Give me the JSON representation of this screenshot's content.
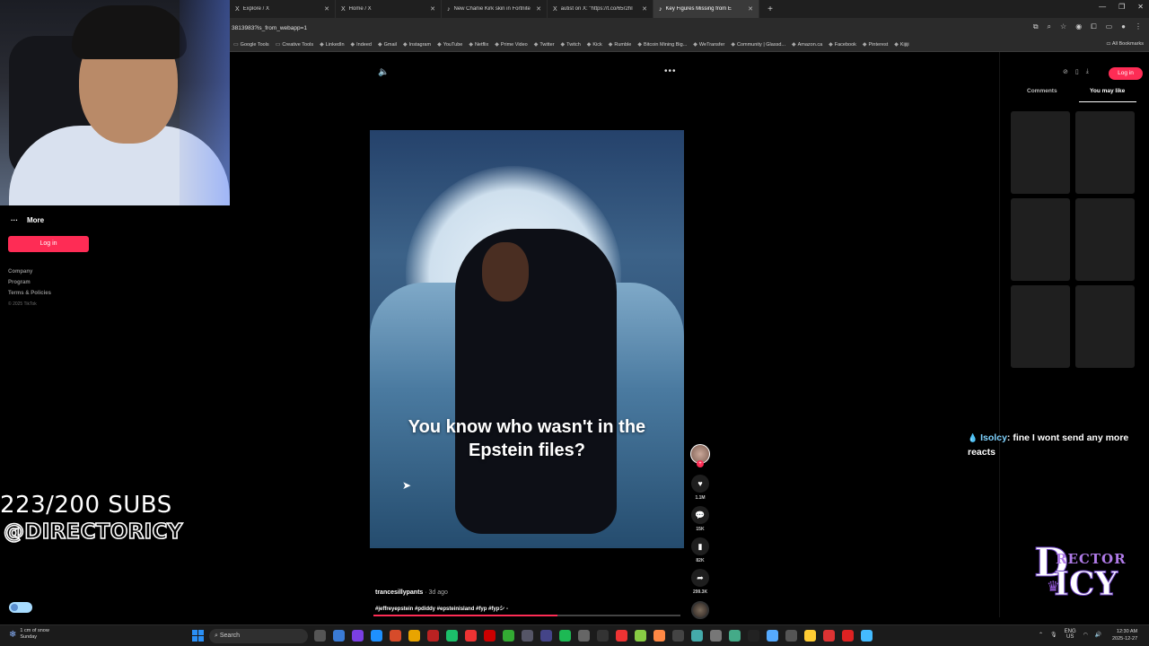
{
  "tabs": [
    {
      "icon": "X",
      "label": "Explore / X",
      "active": false
    },
    {
      "icon": "X",
      "label": "Home / X",
      "active": false
    },
    {
      "icon": "♪",
      "label": "New Charlie Kirk skin in Fortnite",
      "active": false
    },
    {
      "icon": "X",
      "label": "autist on X: \"https://t.co/65r2hI",
      "active": false
    },
    {
      "icon": "♪",
      "label": "Key Figures Missing from E",
      "active": true
    }
  ],
  "address": {
    "url": "3813983?is_from_webapp=1"
  },
  "bookmarks": [
    "Google Tools",
    "Creative Tools",
    "LinkedIn",
    "Indeed",
    "Gmail",
    "Instagram",
    "YouTube",
    "Netflix",
    "Prime Video",
    "Twitter",
    "Twitch",
    "Kick",
    "Rumble",
    "Bitcoin Mining Big...",
    "WeTransfer",
    "Community | Glassd...",
    "Amazon.ca",
    "Facebook",
    "Pinterest",
    "Kijiji"
  ],
  "all_bookmarks": "All Bookmarks",
  "sidebar": {
    "more_label": "More",
    "login_label": "Log in",
    "footer_links": [
      "Company",
      "Program",
      "Terms & Policies"
    ],
    "copyright": "© 2025 TikTok"
  },
  "overlay": {
    "subs": "223/200 SUBS",
    "handle": "@DIRECTORICY",
    "chat_user": "Isolcy",
    "chat_message": ": fine I wont send any more reacts"
  },
  "video": {
    "caption_line1": "You know who wasn't in the",
    "caption_line2": "Epstein files?",
    "author": "trancesillypants",
    "ago": "· 3d ago",
    "tags": "#jeffreyepstein #pdiddy #epsteinisland #fyp #fypシ -",
    "progress": 0.6
  },
  "actions": {
    "likes": "1.1M",
    "comments": "15K",
    "saves": "82K",
    "shares": "299.3K"
  },
  "right_panel": {
    "login_label": "Log in",
    "tab_comments": "Comments",
    "tab_you_may_like": "You may like"
  },
  "taskbar": {
    "weather_line1": "1 cm of snow",
    "weather_line2": "Sunday",
    "search_label": "Search",
    "lang1": "ENG",
    "lang2": "US",
    "time": "12:30 AM",
    "date": "2025-12-27"
  },
  "logo": {
    "d": "D",
    "rector": "RECTOR",
    "icy": "ICY"
  },
  "colors": {
    "accent": "#fe2c55",
    "chat_user": "#7fd3ff"
  }
}
